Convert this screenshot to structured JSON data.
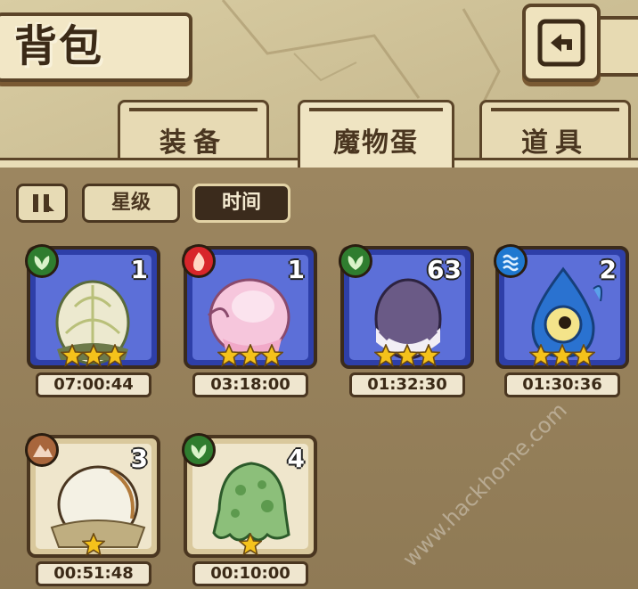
{
  "header": {
    "title": "背包"
  },
  "tabs": [
    {
      "label": "装备",
      "active": false
    },
    {
      "label": "魔物蛋",
      "active": true
    },
    {
      "label": "道具",
      "active": false
    }
  ],
  "sort": {
    "order_toggle_icon": "pause-icon",
    "options": [
      {
        "label": "星级",
        "active": false
      },
      {
        "label": "时间",
        "active": true
      }
    ]
  },
  "eggs": [
    {
      "element": "grass",
      "count": "1",
      "stars": 3,
      "timer": "07:00:44"
    },
    {
      "element": "fire",
      "count": "1",
      "stars": 3,
      "timer": "03:18:00"
    },
    {
      "element": "grass",
      "count": "63",
      "stars": 3,
      "timer": "01:32:30"
    },
    {
      "element": "water",
      "count": "2",
      "stars": 3,
      "timer": "01:30:36"
    },
    {
      "element": "earth",
      "count": "3",
      "stars": 1,
      "timer": "00:51:48"
    },
    {
      "element": "grass",
      "count": "4",
      "stars": 1,
      "timer": "00:10:00"
    }
  ],
  "watermark": "www.hackhome.com",
  "colors": {
    "rare_frame": "#2e3fa8",
    "common_frame": "#d9c89c",
    "star": "#f5c21b"
  }
}
